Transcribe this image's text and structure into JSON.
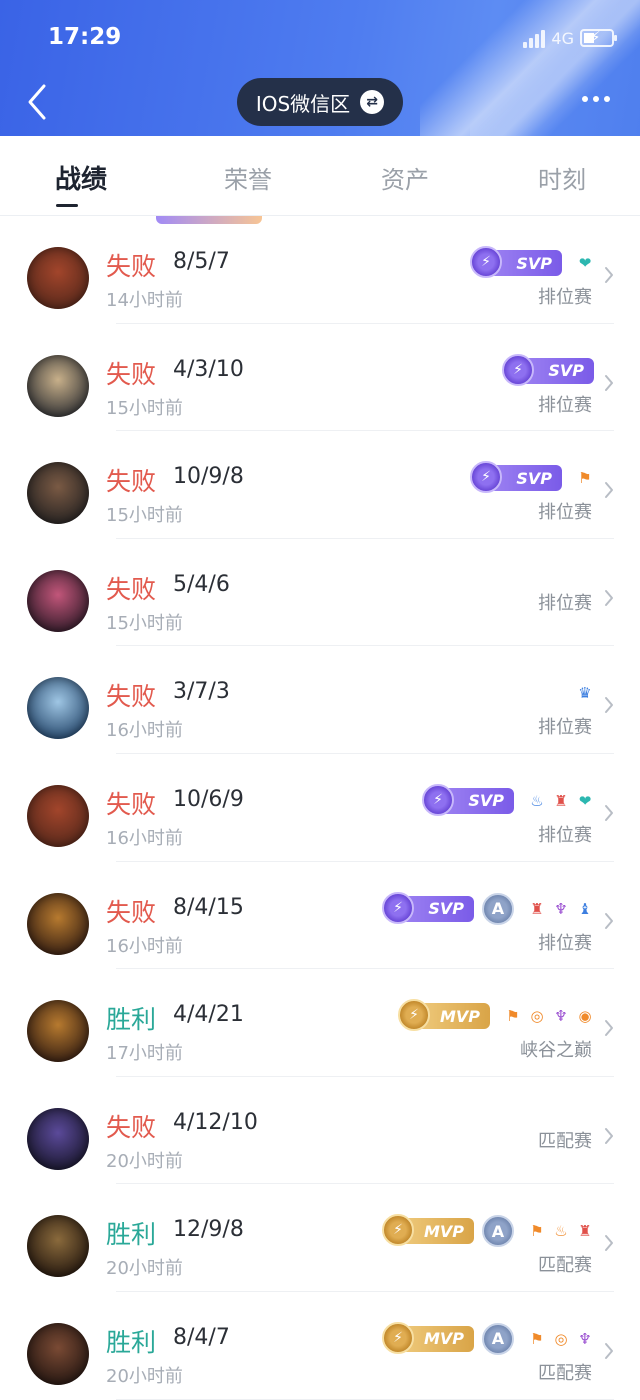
{
  "status_bar": {
    "time": "17:29",
    "network": "4G"
  },
  "header": {
    "server": "IOS微信区"
  },
  "tabs": [
    "战绩",
    "荣誉",
    "资产",
    "时刻"
  ],
  "colors": {
    "lose": "#e25a4e",
    "win": "#2aa898",
    "header": "#3a63e6"
  },
  "matches": [
    {
      "result": "失败",
      "kda": "8/5/7",
      "time": "14小时前",
      "mode": "排位赛",
      "badges": [
        "svp"
      ],
      "icons": [
        "teal-heart-icon"
      ],
      "hero_colors": [
        "#5b2a1c",
        "#a2452b"
      ]
    },
    {
      "result": "失败",
      "kda": "4/3/10",
      "time": "15小时前",
      "mode": "排位赛",
      "badges": [
        "svp"
      ],
      "icons": [],
      "hero_colors": [
        "#3b3a3a",
        "#c8b08a"
      ]
    },
    {
      "result": "失败",
      "kda": "10/9/8",
      "time": "15小时前",
      "mode": "排位赛",
      "badges": [
        "svp"
      ],
      "icons": [
        "orange-flag-icon"
      ],
      "hero_colors": [
        "#2b2624",
        "#7a5a44"
      ]
    },
    {
      "result": "失败",
      "kda": "5/4/6",
      "time": "15小时前",
      "mode": "排位赛",
      "badges": [],
      "icons": [],
      "hero_colors": [
        "#3a1f2e",
        "#c2567a"
      ]
    },
    {
      "result": "失败",
      "kda": "3/7/3",
      "time": "16小时前",
      "mode": "排位赛",
      "badges": [],
      "icons": [
        "blue-crown-icon"
      ],
      "hero_colors": [
        "#2d4f73",
        "#9fc6e4"
      ]
    },
    {
      "result": "失败",
      "kda": "10/6/9",
      "time": "16小时前",
      "mode": "排位赛",
      "badges": [
        "svp"
      ],
      "icons": [
        "blue-flame-icon",
        "red-tower-icon",
        "teal-heart-icon"
      ],
      "hero_colors": [
        "#5b2a1c",
        "#a2452b"
      ]
    },
    {
      "result": "失败",
      "kda": "8/4/15",
      "time": "16小时前",
      "mode": "排位赛",
      "badges": [
        "svp",
        "a"
      ],
      "icons": [
        "red-tower-icon",
        "purple-demon-icon",
        "blue-shield-icon"
      ],
      "hero_colors": [
        "#3d2414",
        "#b77a2f"
      ]
    },
    {
      "result": "胜利",
      "kda": "4/4/21",
      "time": "17小时前",
      "mode": "峡谷之巅",
      "badges": [
        "mvp"
      ],
      "icons": [
        "orange-flag-icon",
        "gold-coins-icon",
        "purple-demon-icon",
        "gold-coins-up-icon"
      ],
      "hero_colors": [
        "#3d2414",
        "#b77a2f"
      ]
    },
    {
      "result": "失败",
      "kda": "4/12/10",
      "time": "20小时前",
      "mode": "匹配赛",
      "badges": [],
      "icons": [],
      "hero_colors": [
        "#1d1a33",
        "#5b4a9a"
      ]
    },
    {
      "result": "胜利",
      "kda": "12/9/8",
      "time": "20小时前",
      "mode": "匹配赛",
      "badges": [
        "mvp",
        "a"
      ],
      "icons": [
        "orange-flag-icon",
        "orange-fire-icon",
        "red-tower-icon"
      ],
      "hero_colors": [
        "#2b1d12",
        "#8a6a3c"
      ]
    },
    {
      "result": "胜利",
      "kda": "8/4/7",
      "time": "20小时前",
      "mode": "匹配赛",
      "badges": [
        "mvp",
        "a"
      ],
      "icons": [
        "orange-flag-icon",
        "gold-coins-icon",
        "purple-demon-icon"
      ],
      "hero_colors": [
        "#2a1a14",
        "#7a4a34"
      ]
    }
  ],
  "badge_labels": {
    "svp": "SVP",
    "mvp": "MVP",
    "a": "A"
  }
}
